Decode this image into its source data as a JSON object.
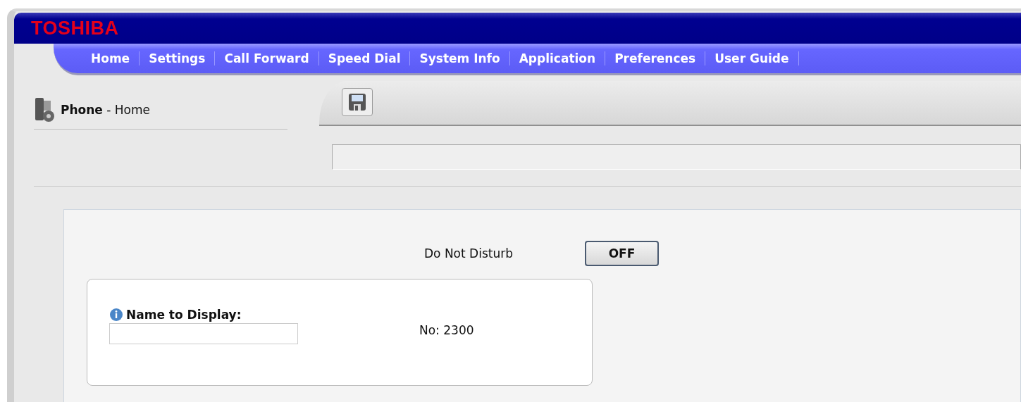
{
  "header": {
    "logo": "TOSHIBA"
  },
  "nav": [
    {
      "label": "Home"
    },
    {
      "label": "Settings"
    },
    {
      "label": "Call Forward"
    },
    {
      "label": "Speed Dial"
    },
    {
      "label": "System Info"
    },
    {
      "label": "Application"
    },
    {
      "label": "Preferences"
    },
    {
      "label": "User Guide"
    }
  ],
  "page_title": "**Phone** - Home",
  "do_not_disturb": {
    "label": "Do Not Disturb",
    "button": "OFF"
  },
  "name_field": {
    "label": "Name to Display:"
  },
  "number": "No: 2300"
}
